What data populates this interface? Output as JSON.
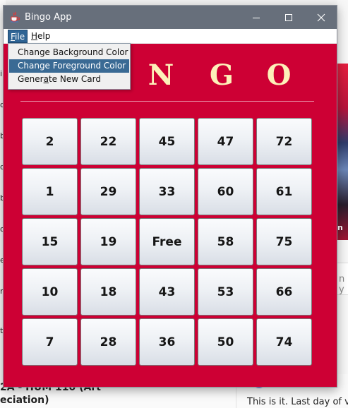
{
  "window": {
    "title": "Bingo App"
  },
  "menubar": {
    "file": {
      "mnemonic": "F",
      "rest": "ile"
    },
    "help": {
      "mnemonic": "H",
      "rest": "elp"
    }
  },
  "file_menu": {
    "items": [
      {
        "label": "Change Background Color",
        "highlighted": false
      },
      {
        "label": "Change Foreground Color",
        "highlighted": true
      },
      {
        "pre": "Gener",
        "mnemonic": "a",
        "post": "te New Card",
        "highlighted": false
      }
    ]
  },
  "header": {
    "letters": [
      "N",
      "G",
      "O"
    ]
  },
  "card": {
    "rows": [
      [
        "2",
        "22",
        "45",
        "47",
        "72"
      ],
      [
        "1",
        "29",
        "33",
        "60",
        "61"
      ],
      [
        "15",
        "19",
        "Free",
        "58",
        "75"
      ],
      [
        "10",
        "18",
        "43",
        "53",
        "66"
      ],
      [
        "7",
        "28",
        "36",
        "50",
        "74"
      ]
    ]
  },
  "background": {
    "left_letters": [
      "i",
      "d",
      "b",
      "d",
      "b",
      "o",
      "e",
      "n",
      "t"
    ],
    "right_photo_text": "n",
    "right_search_text": "n y",
    "bottom_left_text_1": "2A - HUM 110 (Art",
    "bottom_left_text_2": "eciation)",
    "bottom_right_text": "This is it. Last day of v"
  },
  "colors": {
    "window_background": "#cd0034",
    "header_text": "#fdf1b9",
    "titlebar": "#676f7b",
    "menu_highlight": "#3a6a94"
  },
  "icons": {
    "app": "java-cup-icon",
    "minimize": "minimize-icon",
    "maximize": "maximize-icon",
    "close": "close-icon"
  }
}
